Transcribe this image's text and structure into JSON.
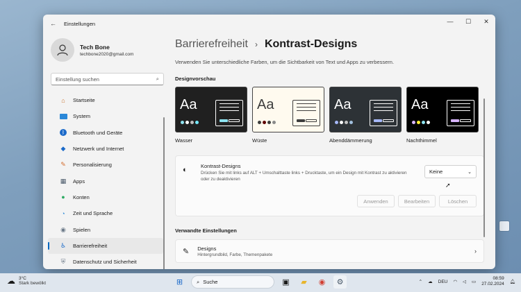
{
  "window": {
    "title": "Einstellungen"
  },
  "profile": {
    "name": "Tech Bone",
    "email": "techbone2020@gmail.com"
  },
  "search": {
    "placeholder": "Einstellung suchen"
  },
  "nav": [
    {
      "label": "Startseite",
      "icon": "home-icon"
    },
    {
      "label": "System",
      "icon": "monitor-icon"
    },
    {
      "label": "Bluetooth und Geräte",
      "icon": "bluetooth-icon"
    },
    {
      "label": "Netzwerk und Internet",
      "icon": "wifi-icon"
    },
    {
      "label": "Personalisierung",
      "icon": "brush-icon"
    },
    {
      "label": "Apps",
      "icon": "apps-icon"
    },
    {
      "label": "Konten",
      "icon": "user-icon"
    },
    {
      "label": "Zeit und Sprache",
      "icon": "globe-clock-icon"
    },
    {
      "label": "Spielen",
      "icon": "gamepad-icon"
    },
    {
      "label": "Barrierefreiheit",
      "icon": "accessibility-icon",
      "active": true
    },
    {
      "label": "Datenschutz und Sicherheit",
      "icon": "shield-icon"
    }
  ],
  "breadcrumb": {
    "parent": "Barrierefreiheit",
    "separator": "›",
    "current": "Kontrast-Designs"
  },
  "description": "Verwenden Sie unterschiedliche Farben, um die Sichtbarkeit von Text und Apps zu verbessern.",
  "preview_section": {
    "title": "Designvorschau"
  },
  "themes": [
    {
      "name": "Wasser",
      "bg": "#202020",
      "fg": "#ffffff",
      "box": "#ffffff",
      "btn": "#8ee3f0",
      "dots": [
        "#8ee3f0",
        "#ffffff",
        "#c0c0c0",
        "#75e9fc"
      ]
    },
    {
      "name": "Wüste",
      "bg": "#fffaef",
      "fg": "#3d3d3d",
      "box": "#3d3d3d",
      "btn": "#3d3d3d",
      "dots": [
        "#3d3d3d",
        "#600000",
        "#3d3d3d",
        "#8a8a8a"
      ]
    },
    {
      "name": "Abenddämmerung",
      "bg": "#2d3236",
      "fg": "#ffffff",
      "box": "#ffffff",
      "btn": "#a6b8f8",
      "dots": [
        "#a6b8f8",
        "#ffffff",
        "#c0c0c0",
        "#a1bfde"
      ]
    },
    {
      "name": "Nachthimmel",
      "bg": "#000000",
      "fg": "#ffffff",
      "box": "#ffffff",
      "btn": "#d6b4fd",
      "dots": [
        "#d6b4fd",
        "#ffee32",
        "#8ee3f0",
        "#ffffff"
      ]
    }
  ],
  "contrast_card": {
    "title": "Kontrast-Designs",
    "subtitle": "Drücken Sie mit links auf ALT + Umschalttaste links + Drucktaste, um ein Design mit Kontrast zu aktivieren oder zu deaktivieren",
    "select_value": "Keine",
    "buttons": {
      "apply": "Anwenden",
      "edit": "Bearbeiten",
      "delete": "Löschen"
    }
  },
  "related": {
    "title": "Verwandte Einstellungen",
    "items": [
      {
        "title": "Designs",
        "subtitle": "Hintergrundbild, Farbe, Themenpakete"
      }
    ]
  },
  "taskbar": {
    "weather_temp": "3°C",
    "weather_desc": "Stark bewölkt",
    "search_label": "Suche",
    "language": "DEU",
    "time": "08:59",
    "date": "27.02.2024"
  },
  "colors": {
    "accent": "#0067c0"
  }
}
